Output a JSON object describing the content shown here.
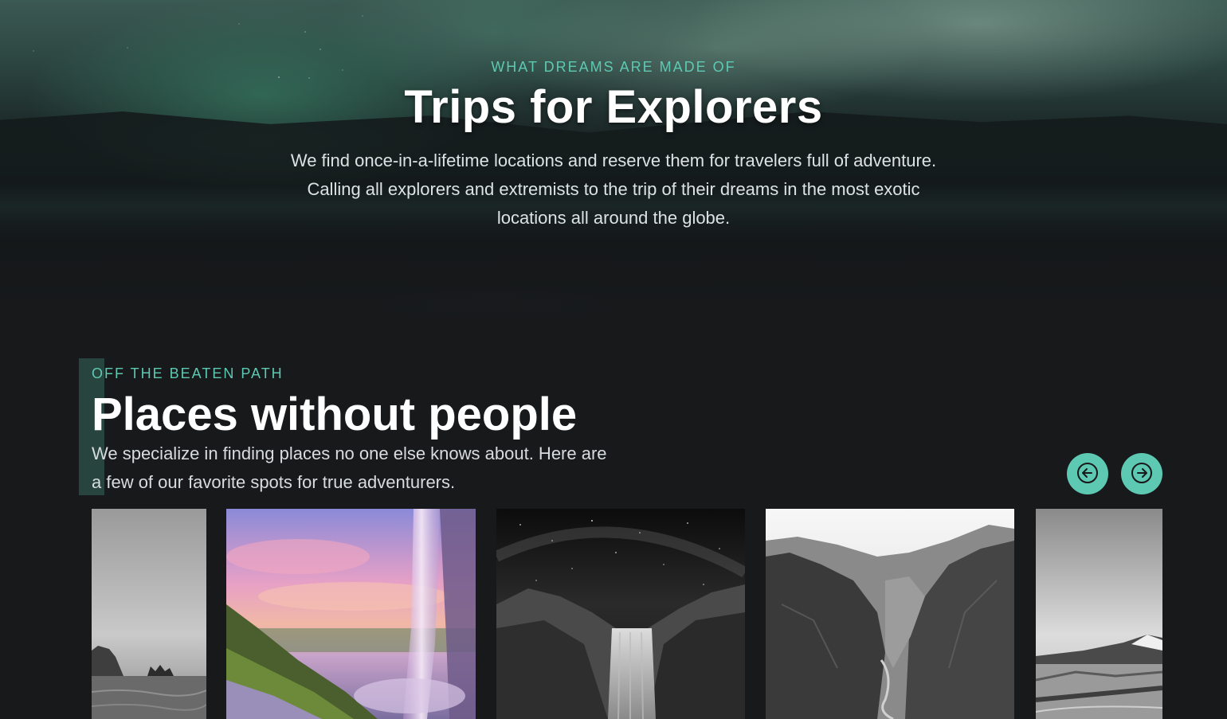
{
  "hero": {
    "eyebrow": "WHAT DREAMS ARE MADE OF",
    "title": "Trips for Explorers",
    "description": "We find once-in-a-lifetime locations and reserve them for travelers full of adventure. Calling all explorers and extremists to the trip of their dreams in the most exotic locations all around the globe."
  },
  "section": {
    "eyebrow": "OFF THE BEATEN PATH",
    "title": "Places without people",
    "description": "We specialize in finding places no one else knows about. Here are a few of our favorite spots for true adventurers.",
    "prev_icon": "arrow-left-circle-icon",
    "next_icon": "arrow-right-circle-icon"
  },
  "carousel": {
    "cards": [
      {
        "subject": "sea-stacks-coast-photo"
      },
      {
        "subject": "waterfall-sunset-photo"
      },
      {
        "subject": "waterfall-night-sky-photo"
      },
      {
        "subject": "canyon-photo"
      },
      {
        "subject": "coastal-road-mountain-photo"
      }
    ]
  },
  "colors": {
    "accent": "#5ec9b3",
    "background": "#17191b",
    "accent_bar": "#27443e",
    "heading": "#ffffff"
  }
}
